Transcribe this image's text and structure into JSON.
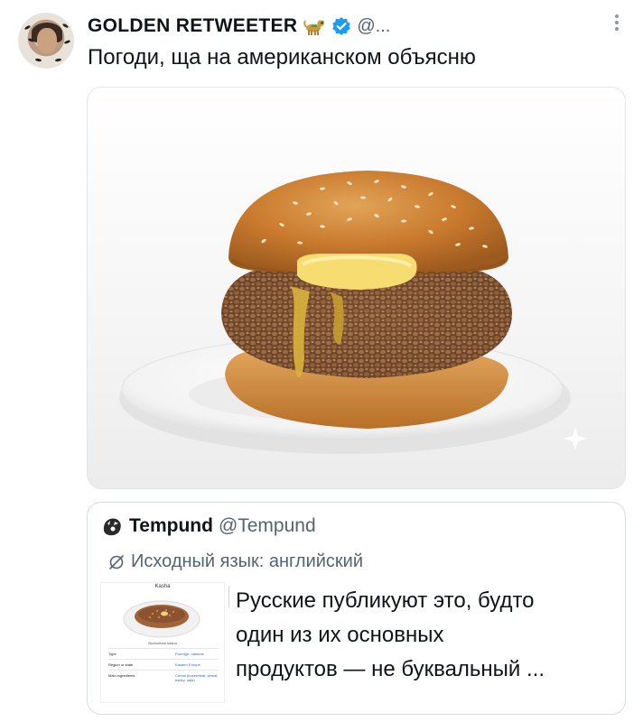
{
  "tweet": {
    "display_name": "GOLDEN RETWEETER",
    "handle": "@...",
    "text": "Погоди, ща на американском объясню"
  },
  "media": {
    "alt": "buckwheat burger with butter on a white plate"
  },
  "quote": {
    "display_name": "Tempund",
    "handle": "@Tempund",
    "translation_label": "Исходный язык: английский",
    "text_lines": [
      "Русские публикуют это, будто",
      "один из их основных",
      "продуктов — не буквальный ..."
    ],
    "thumbnail": {
      "title": "Kasha",
      "caption": "Buckwheat kasha",
      "rows": [
        {
          "label": "Type",
          "value": "Porridge, oatmeal"
        },
        {
          "label": "Region or state",
          "value": "Eastern Europe"
        },
        {
          "label": "Main ingredients",
          "value": "Cereal (buckwheat, wheat, barley, oats)"
        }
      ]
    }
  },
  "colors": {
    "verified": "#1d9bf0",
    "secondary_text": "#536471",
    "border": "#d7dde1"
  },
  "icons": {
    "verified": "verified-badge-icon",
    "dog": "dog-emoji-icon",
    "more": "more-options-icon",
    "translate": "translate-icon"
  }
}
